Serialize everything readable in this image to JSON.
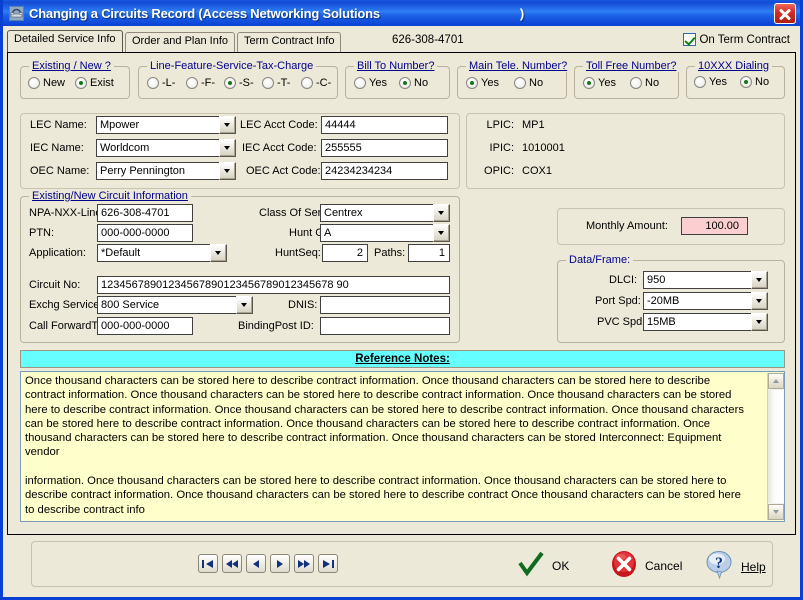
{
  "window": {
    "title": "Changing a Circuits Record  (Access Networking Solutions",
    "title_suffix": ")",
    "icon": "telephone-icon",
    "close_label": "x",
    "accent": "#0a3fd4",
    "face": "#ece9d8"
  },
  "tabs": [
    {
      "label": "Detailed Service Info",
      "active": true
    },
    {
      "label": "Order and Plan Info",
      "active": false
    },
    {
      "label": "Term Contract Info",
      "active": false
    }
  ],
  "header": {
    "phone": "626-308-4701",
    "term_contract_label": "On Term Contract",
    "term_contract_checked": true
  },
  "option_groups": [
    {
      "title": "Existing / New ?",
      "options": [
        {
          "label": "New",
          "selected": false
        },
        {
          "label": "Exist",
          "selected": true
        }
      ]
    },
    {
      "title": "Line-Feature-Service-Tax-Charge",
      "options": [
        {
          "label": "-L-",
          "selected": false
        },
        {
          "label": "-F-",
          "selected": false
        },
        {
          "label": "-S-",
          "selected": true
        },
        {
          "label": "-T-",
          "selected": false
        },
        {
          "label": "-C-",
          "selected": false
        }
      ]
    },
    {
      "title": "Bill To Number?",
      "options": [
        {
          "label": "Yes",
          "selected": false
        },
        {
          "label": "No",
          "selected": true
        }
      ]
    },
    {
      "title": "Main Tele. Number?",
      "options": [
        {
          "label": "Yes",
          "selected": true
        },
        {
          "label": "No",
          "selected": false
        }
      ]
    },
    {
      "title": "Toll Free Number?",
      "options": [
        {
          "label": "Yes",
          "selected": true
        },
        {
          "label": "No",
          "selected": false
        }
      ]
    },
    {
      "title": "10XXX Dialing",
      "options": [
        {
          "label": "Yes",
          "selected": false
        },
        {
          "label": "No",
          "selected": true
        }
      ]
    }
  ],
  "carrier": {
    "lec_name_label": "LEC Name:",
    "lec_name_value": "Mpower",
    "iec_name_label": "IEC Name:",
    "iec_name_value": "Worldcom",
    "oec_name_label": "OEC Name:",
    "oec_name_value": "Perry Pennington",
    "lec_acct_label": "LEC Acct Code:",
    "lec_acct_value": "44444",
    "iec_acct_label": "IEC Acct Code:",
    "iec_acct_value": "255555",
    "oec_acct_label": "OEC Act Code:",
    "oec_acct_value": "24234234234",
    "lpic_label": "LPIC:",
    "lpic_value": "MP1",
    "ipic_label": "IPIC:",
    "ipic_value": "1010001",
    "opic_label": "OPIC:",
    "opic_value": "COX1"
  },
  "circuit": {
    "group_title": "Existing/New Circuit Information",
    "npa_label": "NPA-NXX-Line:",
    "npa_value": "626-308-4701",
    "ptn_label": "PTN:",
    "ptn_value": "000-000-0000",
    "application_label": "Application:",
    "application_value": "*Default",
    "circuit_no_label": "Circuit No:",
    "circuit_no_value": "12345678901234567890123456789012345678 90",
    "exchg_label": "Exchg Service:",
    "exchg_value": "800 Service",
    "callfwd_label": "Call ForwardTo:",
    "callfwd_value": "000-000-0000",
    "class_label": "Class Of Service:",
    "class_value": "Centrex",
    "hunt_group_label": "Hunt Group:",
    "hunt_group_value": "A",
    "huntseq_label": "HuntSeq:",
    "huntseq_value": "2",
    "paths_label": "Paths:",
    "paths_value": "1",
    "dnis_label": "DNIS:",
    "dnis_value": "",
    "bindingpost_label": "BindingPost ID:",
    "bindingpost_value": ""
  },
  "monthly": {
    "label": "Monthly Amount:",
    "value": "100.00",
    "field_color": "#fbcfcf"
  },
  "dataframe": {
    "group_title": "Data/Frame:",
    "dlci_label": "DLCI:",
    "dlci_value": "950",
    "port_label": "Port Spd:",
    "port_value": "-20MB",
    "pvc_label": "PVC Spd:",
    "pvc_value": "15MB"
  },
  "notes": {
    "header": "Reference Notes:",
    "header_color": "#66ffff",
    "body_color": "#ffffcc",
    "text": "Once thousand characters can be stored here to describe contract information. Once thousand characters can be stored here to describe contract information. Once thousand characters can be stored here to describe contract information. Once thousand characters can be stored here to describe contract information. Once thousand characters can be stored here to describe contract information. Once thousand characters can be stored here to describe contract information. Once thousand characters can be stored here to describe contract information. Once thousand characters can be stored here to describe contract information. Once thousand characters can be stored Interconnect: Equipment vendor\n\ninformation. Once thousand characters can be stored here to describe contract information. Once thousand characters can be stored here to describe contract information. Once thousand characters can be stored here to describe contract Once thousand characters can be stored here to describe contract info"
  },
  "navigation": [
    {
      "name": "first-record-button",
      "glyph": "first"
    },
    {
      "name": "prev-page-button",
      "glyph": "rewind"
    },
    {
      "name": "prev-record-button",
      "glyph": "prev"
    },
    {
      "name": "next-record-button",
      "glyph": "next"
    },
    {
      "name": "next-page-button",
      "glyph": "forward"
    },
    {
      "name": "last-record-button",
      "glyph": "last"
    }
  ],
  "actions": {
    "ok_label": "OK",
    "cancel_label": "Cancel",
    "help_label": "Help",
    "ok_icon": "green-check-icon",
    "cancel_icon": "red-x-circle-icon",
    "help_icon": "question-balloon-icon"
  }
}
